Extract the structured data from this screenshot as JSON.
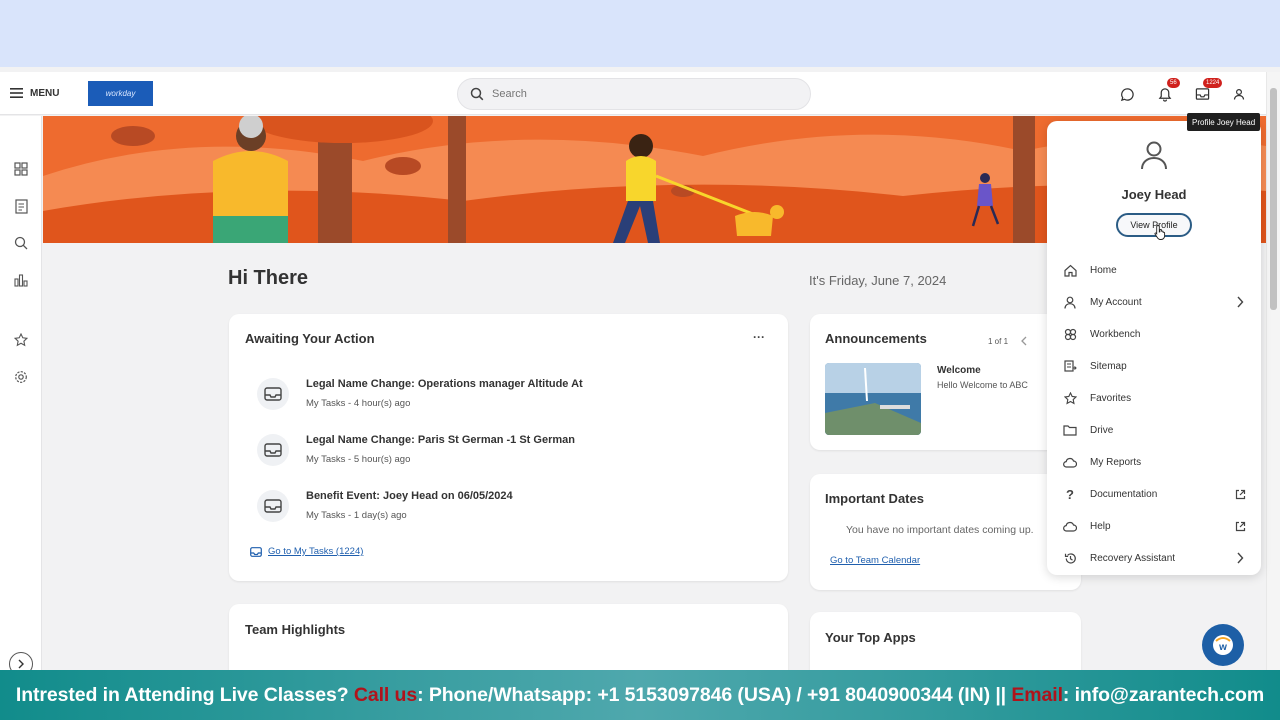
{
  "header": {
    "menu_label": "MENU",
    "logo_text": "workday",
    "search_placeholder": "Search",
    "notifications_count": "56",
    "inbox_count": "1224"
  },
  "tooltip": "Profile Joey Head",
  "greeting": "Hi There",
  "date_line": "It's Friday, June 7, 2024",
  "awaiting": {
    "title": "Awaiting Your Action",
    "more_label": "···",
    "tasks": [
      {
        "title": "Legal Name Change: Operations manager Altitude At",
        "sub": "My Tasks - 4 hour(s) ago"
      },
      {
        "title": "Legal Name Change: Paris St German -1 St German",
        "sub": "My Tasks - 5 hour(s) ago"
      },
      {
        "title": "Benefit Event: Joey Head on 06/05/2024",
        "sub": "My Tasks - 1 day(s) ago"
      }
    ],
    "go_link": "Go to My Tasks (1224)"
  },
  "announcements": {
    "title": "Announcements",
    "pager": "1 of 1",
    "item_title": "Welcome",
    "item_text": "Hello Welcome to ABC"
  },
  "important_dates": {
    "title": "Important Dates",
    "empty_text": "You have no important dates coming up.",
    "link": "Go to Team Calendar"
  },
  "team_highlights": {
    "title": "Team Highlights"
  },
  "top_apps": {
    "title": "Your Top Apps"
  },
  "profile": {
    "name": "Joey Head",
    "view_profile": "View Profile",
    "menu": [
      {
        "label": "Home",
        "icon": "home-icon",
        "trail": ""
      },
      {
        "label": "My Account",
        "icon": "person-icon",
        "trail": "chevron"
      },
      {
        "label": "Workbench",
        "icon": "workbench-icon",
        "trail": ""
      },
      {
        "label": "Sitemap",
        "icon": "sitemap-icon",
        "trail": ""
      },
      {
        "label": "Favorites",
        "icon": "star-icon",
        "trail": ""
      },
      {
        "label": "Drive",
        "icon": "folder-icon",
        "trail": ""
      },
      {
        "label": "My Reports",
        "icon": "cloud-icon",
        "trail": ""
      },
      {
        "label": "Documentation",
        "icon": "question-icon",
        "trail": "external"
      },
      {
        "label": "Help",
        "icon": "cloud-icon",
        "trail": "external"
      },
      {
        "label": "Recovery Assistant",
        "icon": "history-icon",
        "trail": "chevron"
      }
    ]
  },
  "footer": {
    "part1": "Intrested in Attending Live Classes? ",
    "call_us": "Call us",
    "part2": ": Phone/Whatsapp: +1 5153097846 (USA) / +91 8040900344 (IN) || ",
    "email": "Email",
    "part3": ": info@zarantech.com"
  },
  "colors": {
    "accent": "#1d5fa6",
    "banner": "#ee6b2f",
    "badge": "#d0211d",
    "footer": "#118c8b",
    "footer_highlight": "#b0131b"
  }
}
